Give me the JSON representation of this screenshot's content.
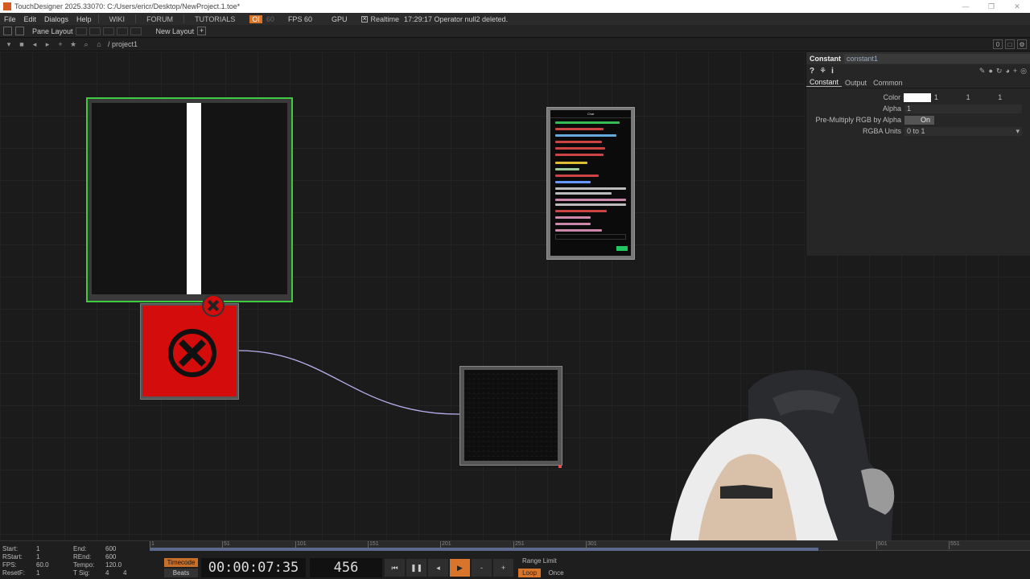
{
  "window": {
    "title": "TouchDesigner 2025.33070: C:/Users/ericr/Desktop/NewProject.1.toe*"
  },
  "menubar": {
    "items": [
      "File",
      "Edit",
      "Dialogs",
      "Help"
    ],
    "wiki": "WIKI",
    "forum": "FORUM",
    "tutorials": "TUTORIALS",
    "oi": "OI",
    "oi_value": "60",
    "fps": "FPS  60",
    "gpu": "GPU",
    "realtime": "Realtime",
    "status": "17:29:17 Operator null2 deleted."
  },
  "panebar": {
    "pane_layout": "Pane Layout",
    "new_layout": "New Layout"
  },
  "pathbar": {
    "path": "/ project1",
    "count": "0"
  },
  "params": {
    "op_type": "Constant",
    "op_name": "constant1",
    "tabs": [
      "Constant",
      "Output",
      "Common"
    ],
    "color_label": "Color",
    "color_values": [
      "1",
      "1",
      "1"
    ],
    "alpha_label": "Alpha",
    "alpha_value": "1",
    "premult_label": "Pre-Multiply RGB by Alpha",
    "premult_value": "On",
    "rgba_units_label": "RGBA Units",
    "rgba_units_value": "0 to 1"
  },
  "chat_preview": {
    "header": "Chat"
  },
  "timeline": {
    "start_label": "Start:",
    "start": "1",
    "end_label": "End:",
    "end": "600",
    "rstart_label": "RStart:",
    "rstart": "1",
    "rend_label": "REnd:",
    "rend": "600",
    "fps_label": "FPS:",
    "fps": "60.0",
    "tempo_label": "Tempo:",
    "tempo": "120.0",
    "resetf_label": "ResetF:",
    "resetf": "1",
    "tsig_label": "T Sig:",
    "tsig_a": "4",
    "tsig_b": "4",
    "ticks": [
      "1",
      "51",
      "101",
      "151",
      "201",
      "251",
      "301",
      "501",
      "551"
    ],
    "current_frame_fraction": 0.76,
    "timecode_btn": "Timecode",
    "beats_btn": "Beats",
    "timecode": "00:00:07:35",
    "frame": "456",
    "range_limit": "Range Limit",
    "loop": "Loop",
    "once": "Once"
  },
  "colors": {
    "selected_node_border": "#3fcb3f",
    "error_red": "#d40c0c",
    "accent_orange": "#d9742b",
    "wire": "#b7b1f0"
  }
}
